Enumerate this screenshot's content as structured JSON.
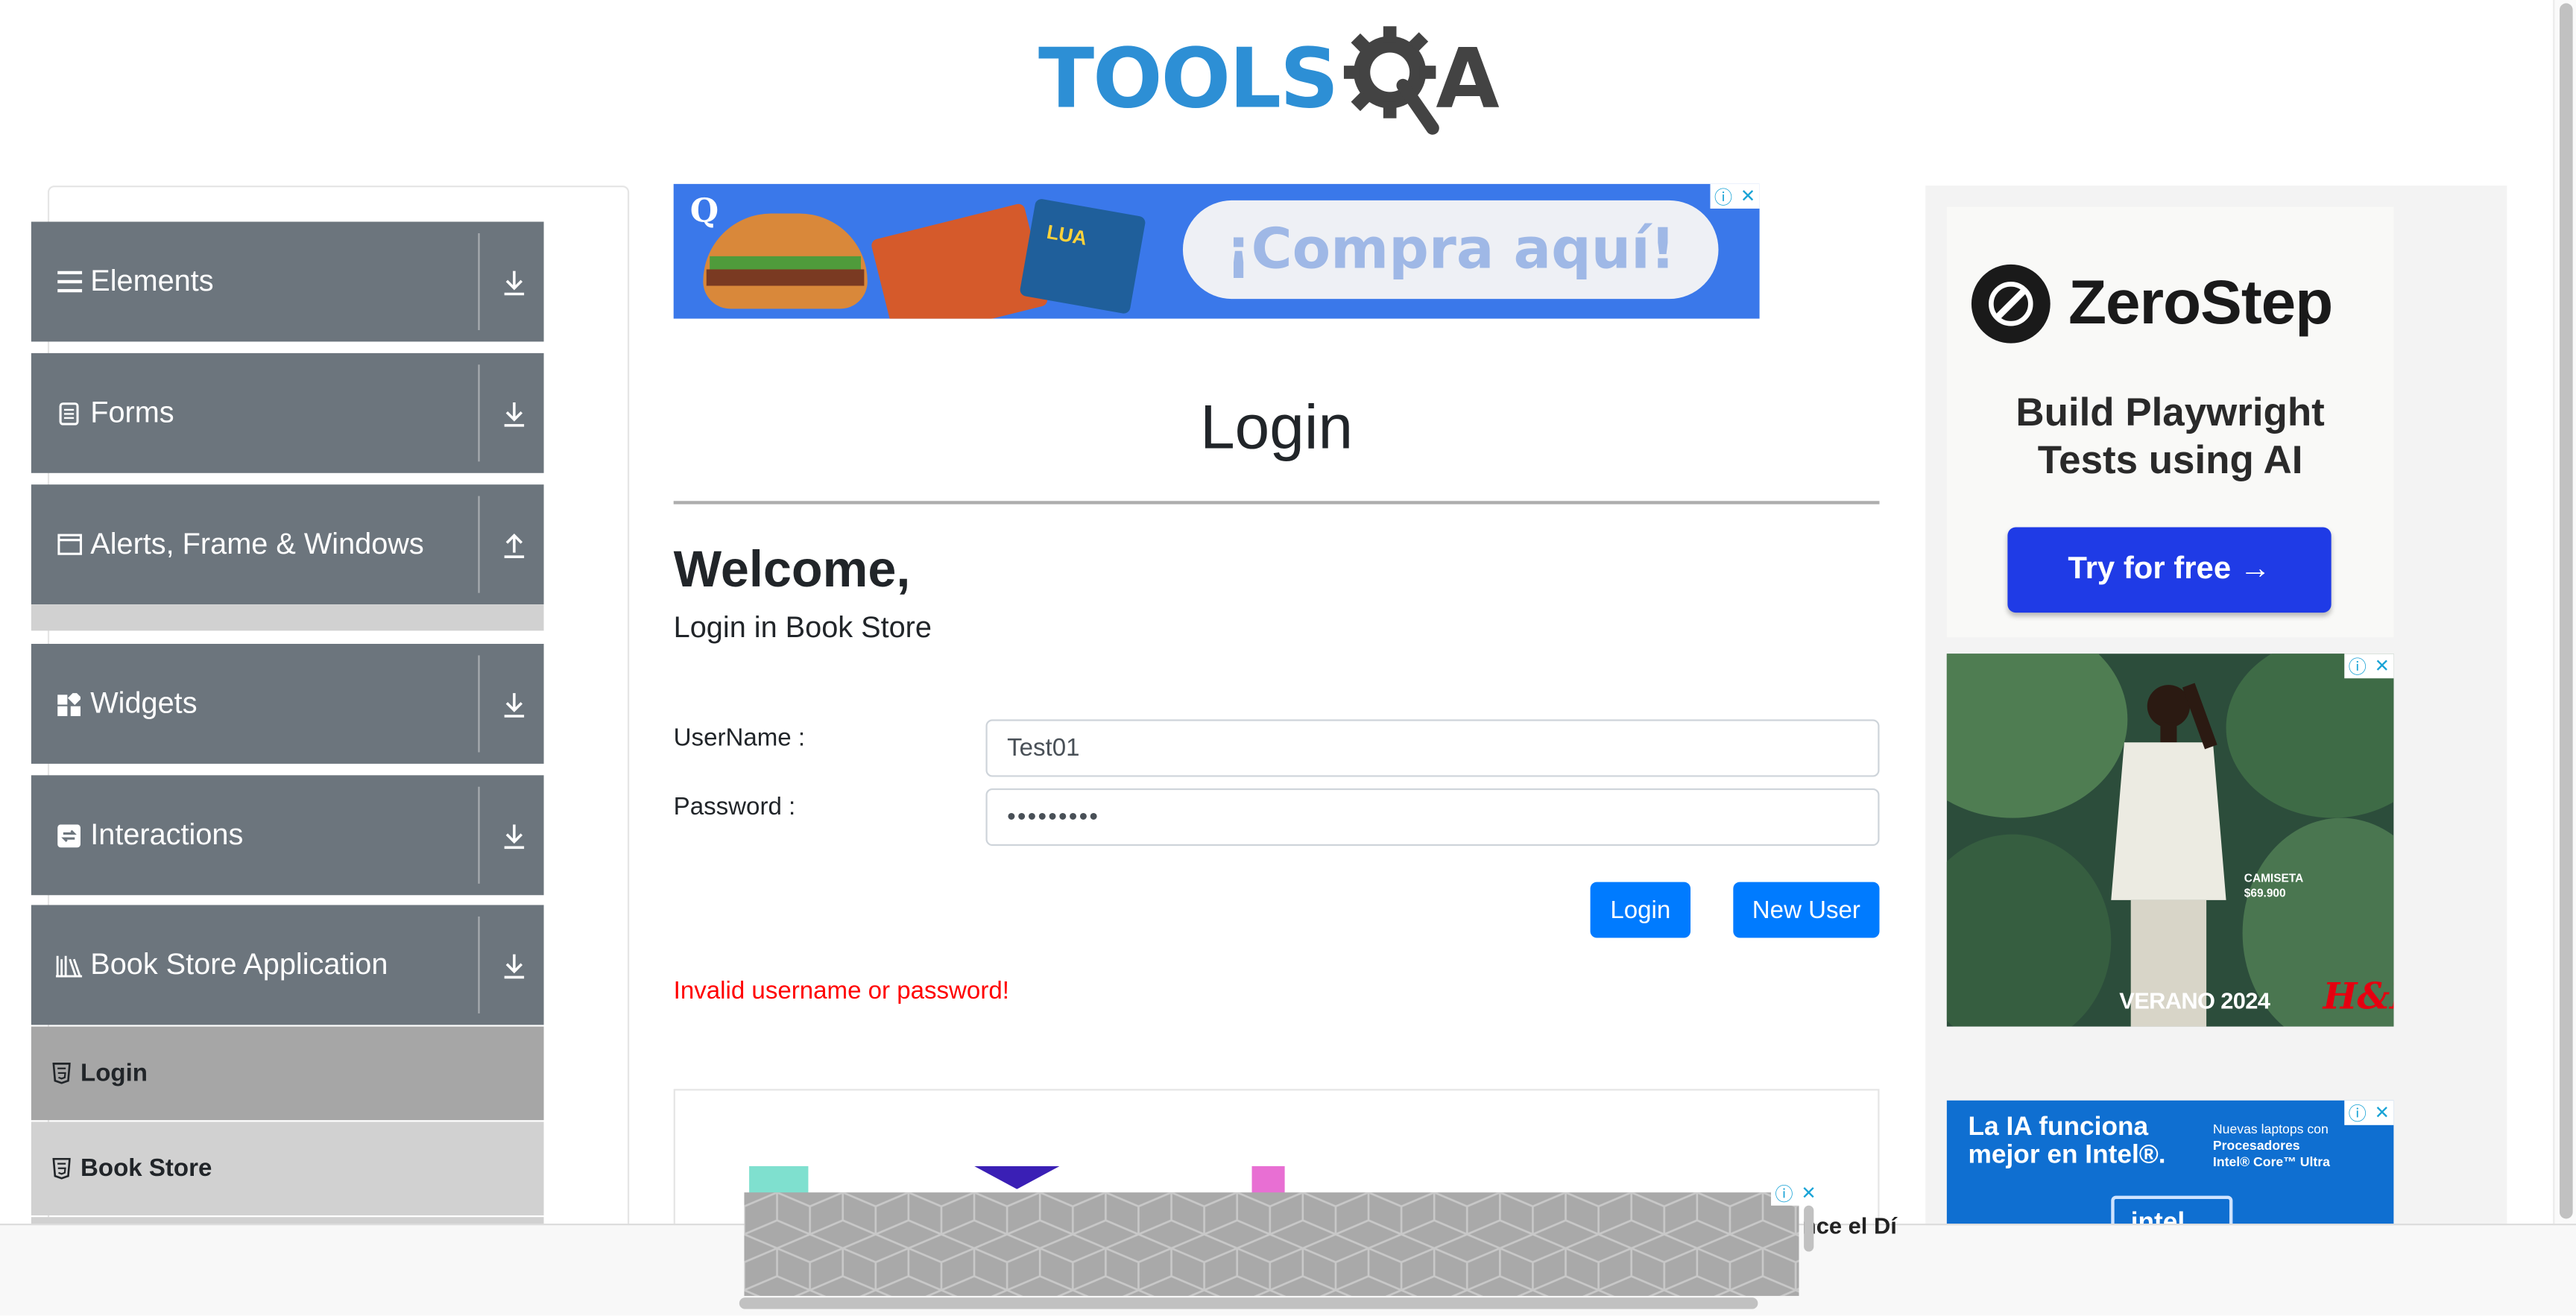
{
  "header": {
    "logo_text": "TOOLS",
    "logo_text_2": "A"
  },
  "sidebar": {
    "groups": [
      {
        "label": "Elements",
        "icon": "hamburger-icon",
        "arrow": "download-arrow-icon"
      },
      {
        "label": "Forms",
        "icon": "form-doc-icon",
        "arrow": "download-arrow-icon"
      },
      {
        "label": "Alerts, Frame & Windows",
        "icon": "window-icon",
        "arrow": "upload-arrow-icon"
      },
      {
        "label": "Widgets",
        "icon": "widgets-grid-icon",
        "arrow": "download-arrow-icon"
      },
      {
        "label": "Interactions",
        "icon": "interaction-icon",
        "arrow": "download-arrow-icon"
      },
      {
        "label": "Book Store Application",
        "icon": "books-icon",
        "arrow": "download-arrow-icon"
      }
    ],
    "book_store_items": [
      {
        "label": "Login",
        "icon": "html5-icon",
        "active": true
      },
      {
        "label": "Book Store",
        "icon": "html5-icon",
        "active": false
      }
    ]
  },
  "ads": {
    "top_banner_text": "¡Compra aquí!",
    "top_banner_pack": "LUA",
    "zerostep_name": "ZeroStep",
    "zerostep_tagline_1": "Build Playwright",
    "zerostep_tagline_2": "Tests using AI",
    "zerostep_cta": "Try for free →",
    "hm_price_1": "CAMISETA",
    "hm_price_2": "$69.900",
    "hm_campaign": "VERANO 2024",
    "hm_brand": "H&M",
    "intel_headline_1": "La IA funciona",
    "intel_headline_2": "mejor en Intel®.",
    "intel_sub_1": "Nuevas laptops con",
    "intel_sub_2": "Procesadores",
    "intel_sub_3": "Intel® Core™ Ultra",
    "intel_logo": "intel",
    "bottom_peek_text": "nce el Dí"
  },
  "main": {
    "header": "Login",
    "welcome": "Welcome,",
    "subtitle": "Login in Book Store",
    "username_label": "UserName :",
    "username_value": "Test01",
    "password_label": "Password :",
    "password_value": "•••••••••",
    "login_button": "Login",
    "new_user_button": "New User",
    "error": "Invalid username or password!"
  },
  "colors": {
    "accent": "#007bff",
    "sidebar_group": "#6c757d",
    "sidebar_active": "#a6a6a6",
    "error": "#ff0000",
    "logo_blue": "#2d8fd5"
  }
}
